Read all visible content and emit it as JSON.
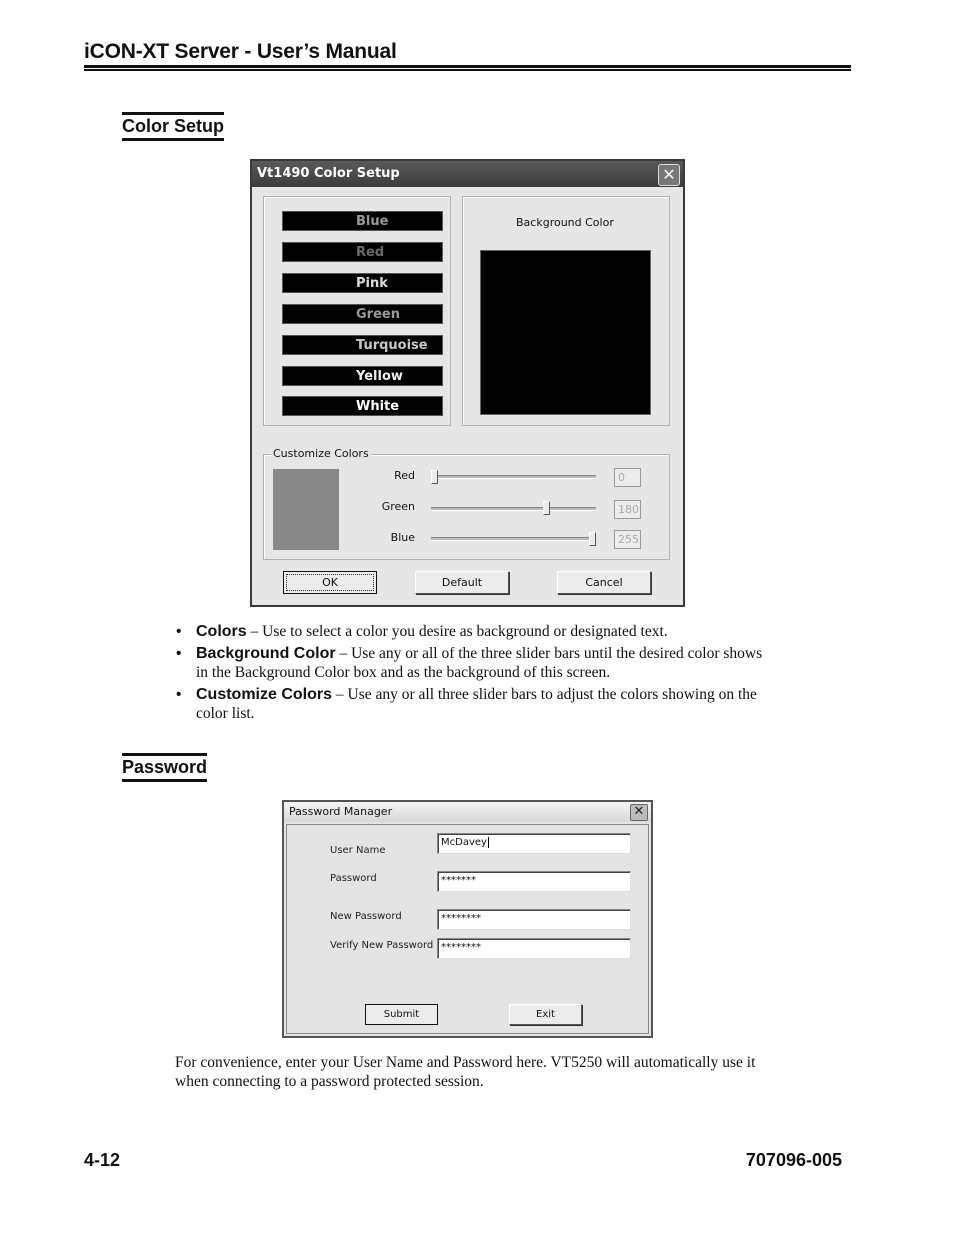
{
  "header": {
    "title": "iCON-XT Server - User’s Manual"
  },
  "sections": {
    "color_setup": {
      "heading": "Color Setup"
    },
    "password": {
      "heading": "Password"
    }
  },
  "color_dialog": {
    "title": "Vt1490 Color Setup",
    "close_icon": "close-icon",
    "color_list": [
      {
        "label": "Blue",
        "text_color": "#9a9a9a"
      },
      {
        "label": "Red",
        "text_color": "#6a6a6a"
      },
      {
        "label": "Pink",
        "text_color": "#dcdcdc"
      },
      {
        "label": "Green",
        "text_color": "#9a9a9a"
      },
      {
        "label": "Turquoise",
        "text_color": "#c8c8c8"
      },
      {
        "label": "Yellow",
        "text_color": "#eeeeee"
      },
      {
        "label": "White",
        "text_color": "#ffffff"
      }
    ],
    "background_color_label": "Background Color",
    "background_color_value": "#000000",
    "customize_label": "Customize Colors",
    "preview_color": "#888888",
    "sliders": [
      {
        "label": "Red",
        "value": 0,
        "max": 255,
        "display": "0"
      },
      {
        "label": "Green",
        "value": 180,
        "max": 255,
        "display": "180"
      },
      {
        "label": "Blue",
        "value": 255,
        "max": 255,
        "display": "255"
      }
    ],
    "buttons": {
      "ok": "OK",
      "default": "Default",
      "cancel": "Cancel"
    }
  },
  "bullets": [
    {
      "term": "Colors",
      "text": " – Use to select a color you desire as background or designated text."
    },
    {
      "term": "Background Color",
      "text": " – Use any or all of the three slider bars until the desired color shows in the Background Color box and as the background of this screen."
    },
    {
      "term": "Customize Colors",
      "text": " – Use any or all three slider bars to adjust the colors showing on the color list."
    }
  ],
  "password_dialog": {
    "title": "Password Manager",
    "fields": [
      {
        "label": "User Name",
        "value": "McDavey"
      },
      {
        "label": "Password",
        "value": "*******"
      },
      {
        "label": "New Password",
        "value": "********"
      },
      {
        "label": "Verify New Password",
        "value": "********"
      }
    ],
    "buttons": {
      "submit": "Submit",
      "exit": "Exit"
    }
  },
  "paragraph": "For convenience, enter your User  Name and Password here. VT5250 will automatically use it when connecting to a password protected session.",
  "footer": {
    "page": "4-12",
    "doc_number": "707096-005"
  }
}
